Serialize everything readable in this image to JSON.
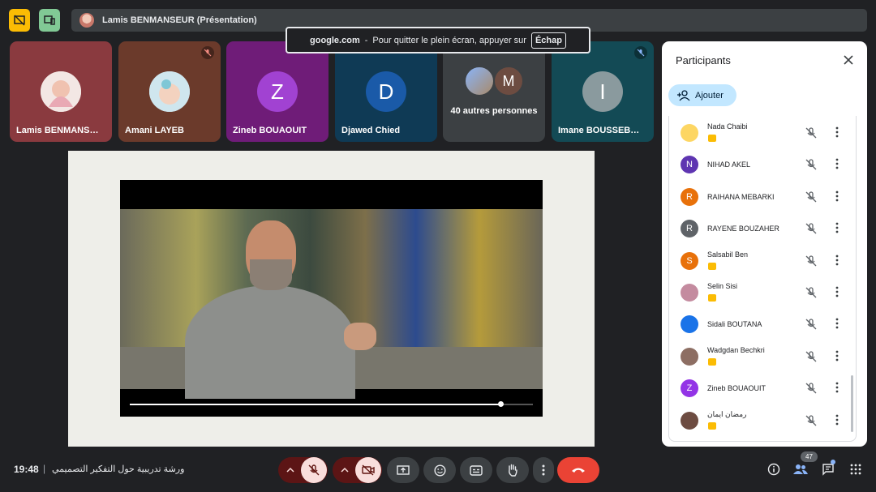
{
  "top_bar": {
    "presenter_label": "Lamis BENMANSEUR (Présentation)"
  },
  "fullscreen_toast": {
    "domain": "google.com",
    "separator": "-",
    "message": "Pour quitter le plein écran, appuyer sur",
    "key": "Échap"
  },
  "tiles": [
    {
      "name": "Lamis BENMANS…"
    },
    {
      "name": "Amani LAYEB"
    },
    {
      "name": "Zineb BOUAOUIT",
      "initial": "Z"
    },
    {
      "name": "Djawed Chied",
      "initial": "D"
    },
    {
      "name": "40 autres personnes",
      "initial": "M"
    },
    {
      "name": "Imane BOUSSEB…",
      "initial": "I"
    }
  ],
  "video": {
    "progress": 0.92
  },
  "participants_panel": {
    "title": "Participants",
    "add_label": "Ajouter",
    "participants": [
      {
        "name": "Nada Chaibi",
        "initial": "",
        "color": "#fdd663",
        "presenting": true
      },
      {
        "name": "NIHAD AKEL",
        "initial": "N",
        "color": "#5e35b1",
        "presenting": false
      },
      {
        "name": "RAIHANA MEBARKI",
        "initial": "R",
        "color": "#e8710a",
        "presenting": false
      },
      {
        "name": "RAYENE BOUZAHER",
        "initial": "R",
        "color": "#5f6368",
        "presenting": false
      },
      {
        "name": "Salsabil Ben",
        "initial": "S",
        "color": "#e8710a",
        "presenting": true
      },
      {
        "name": "Selin Sisi",
        "initial": "",
        "color": "#c48b9f",
        "presenting": true
      },
      {
        "name": "Sidali BOUTANA",
        "initial": "",
        "color": "#1a73e8",
        "presenting": false
      },
      {
        "name": "Wadgdan Bechkri",
        "initial": "",
        "color": "#8d6e63",
        "presenting": true
      },
      {
        "name": "Zineb BOUAOUIT",
        "initial": "Z",
        "color": "#9334e6",
        "presenting": false
      },
      {
        "name": "رمضان ايمان",
        "initial": "",
        "color": "#6d4c41",
        "presenting": true
      }
    ]
  },
  "bottom_bar": {
    "time": "19:48",
    "divider": "|",
    "meeting_name": "ورشة تدريبية حول التفكير التصميمي",
    "participant_count": "47"
  },
  "colors": {
    "end_call": "#ea4335",
    "accent": "#c2e7ff",
    "presenting": "#fbbc04"
  }
}
